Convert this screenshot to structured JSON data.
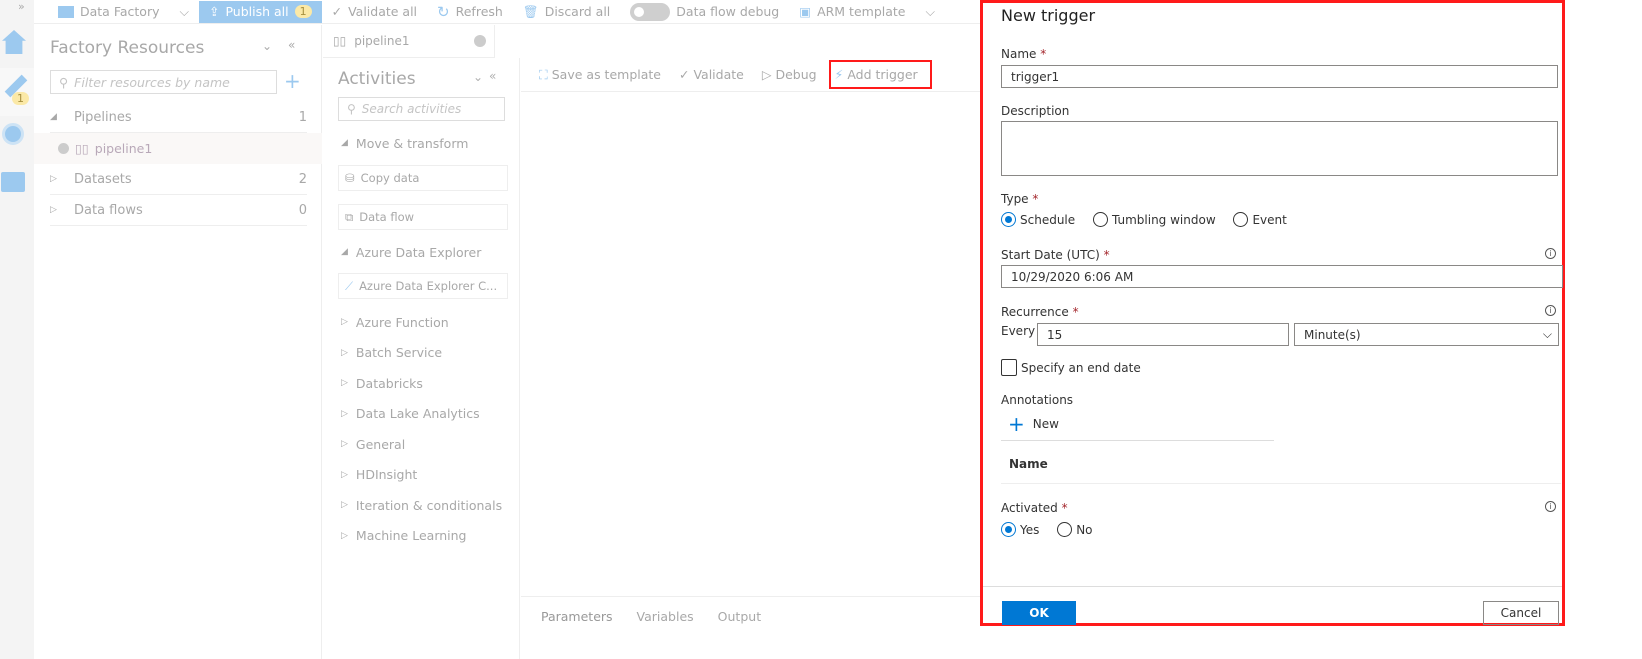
{
  "topbar": {
    "factory": "Data Factory",
    "publish": "Publish all",
    "publish_count": "1",
    "validate_all": "Validate all",
    "refresh": "Refresh",
    "discard": "Discard all",
    "debug_toggle": "Data flow debug",
    "arm": "ARM template"
  },
  "leftnav": {
    "author_badge": "1"
  },
  "resources": {
    "title": "Factory Resources",
    "filter_placeholder": "Filter resources by name",
    "items": [
      {
        "label": "Pipelines",
        "count": "1"
      },
      {
        "label": "Datasets",
        "count": "2"
      },
      {
        "label": "Data flows",
        "count": "0"
      }
    ],
    "pipeline": "pipeline1"
  },
  "tab": {
    "label": "pipeline1"
  },
  "activities": {
    "title": "Activities",
    "search_placeholder": "Search activities",
    "move_transform": "Move & transform",
    "copy": "Copy data",
    "dataflow": "Data flow",
    "ade": "Azure Data Explorer",
    "ade_cmd": "Azure Data Explorer C...",
    "categories": [
      "Azure Function",
      "Batch Service",
      "Databricks",
      "Data Lake Analytics",
      "General",
      "HDInsight",
      "Iteration & conditionals",
      "Machine Learning"
    ]
  },
  "canvas_toolbar": {
    "save_template": "Save as template",
    "validate": "Validate",
    "debug": "Debug",
    "add_trigger": "Add trigger"
  },
  "bottom_tabs": [
    "Parameters",
    "Variables",
    "Output"
  ],
  "trigger": {
    "title": "New trigger",
    "name_label": "Name",
    "name_value": "trigger1",
    "desc_label": "Description",
    "type_label": "Type",
    "types": [
      "Schedule",
      "Tumbling window",
      "Event"
    ],
    "start_label": "Start Date (UTC)",
    "start_value": "10/29/2020 6:06 AM",
    "rec_label": "Recurrence",
    "every": "Every",
    "every_value": "15",
    "unit": "Minute(s)",
    "end_date": "Specify an end date",
    "annotations": "Annotations",
    "new": "New",
    "col_name": "Name",
    "activated": "Activated",
    "yes": "Yes",
    "no": "No",
    "ok": "OK",
    "cancel": "Cancel",
    "req": "*"
  },
  "colors": {
    "accent": "#0078d4",
    "highlight": "#ff1a1a"
  }
}
